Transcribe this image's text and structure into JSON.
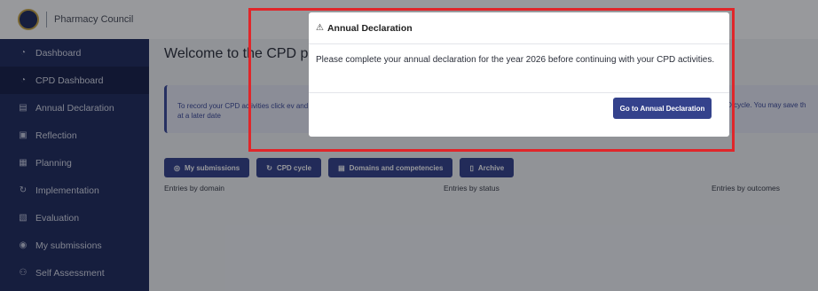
{
  "brand": {
    "name": "Pharmacy Council"
  },
  "sidebar": {
    "items": [
      {
        "label": "Dashboard",
        "icon": "dashboard-icon",
        "glyph": "◔"
      },
      {
        "label": "CPD Dashboard",
        "icon": "dashboard-icon",
        "glyph": "◔"
      },
      {
        "label": "Annual Declaration",
        "icon": "document-icon",
        "glyph": "▤"
      },
      {
        "label": "Reflection",
        "icon": "clipboard-icon",
        "glyph": "▣"
      },
      {
        "label": "Planning",
        "icon": "planning-icon",
        "glyph": "▦"
      },
      {
        "label": "Implementation",
        "icon": "refresh-icon",
        "glyph": "↻"
      },
      {
        "label": "Evaluation",
        "icon": "evaluation-icon",
        "glyph": "▧"
      },
      {
        "label": "My submissions",
        "icon": "check-circle-icon",
        "glyph": "◉"
      },
      {
        "label": "Self Assessment",
        "icon": "users-icon",
        "glyph": "⚇"
      }
    ]
  },
  "main": {
    "welcome": "Welcome to the CPD pl",
    "info_left": "To record your CPD activities click ev and continue at a later date",
    "info_right": "CPD cycle. You may save th",
    "tabs": [
      {
        "label": "My submissions",
        "glyph": "◎"
      },
      {
        "label": "CPD cycle",
        "glyph": "↻"
      },
      {
        "label": "Domains and competencies",
        "glyph": "▤"
      },
      {
        "label": "Archive",
        "glyph": "▯"
      }
    ],
    "entries_domain": "Entries by domain",
    "entries_status": "Entries by status",
    "entries_outcomes": "Entries by outcomes"
  },
  "modal": {
    "title": "Annual Declaration",
    "warn_glyph": "⚠",
    "body": "Please complete your annual declaration for the year 2026 before continuing with your CPD activities.",
    "button": "Go to Annual Declaration"
  },
  "colors": {
    "sidebar": "#1f2b5e",
    "accent": "#34428c",
    "highlight": "#e0262a"
  }
}
